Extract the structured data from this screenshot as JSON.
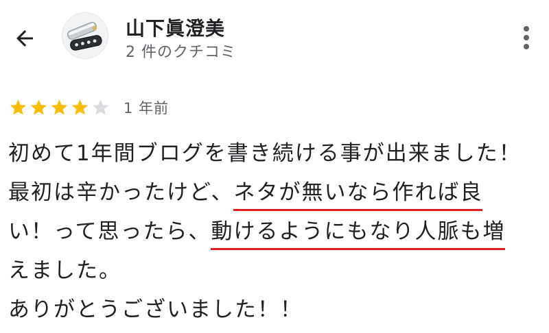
{
  "reviewer": {
    "name": "山下眞澄美",
    "review_count": "2 件のクチコミ"
  },
  "review": {
    "rating": 4,
    "rating_max": 5,
    "time": "1 年前",
    "lines": [
      [
        "初めて1年間ブログを書き続ける事が出来ました！",
        ""
      ],
      [
        "最初は辛かったけど、",
        "ネタが無いなら作れば良"
      ],
      [
        "い！って思ったら、",
        "動けるようにもなり人脈も増"
      ],
      [
        "えました。",
        ""
      ],
      [
        "ありがとうございました！！",
        ""
      ]
    ]
  },
  "colors": {
    "star_filled": "#fbbc04",
    "star_empty": "#dadce0",
    "highlight_underline": "#e02020"
  },
  "icons": {
    "back": "arrow-back-icon",
    "more": "more-vert-icon"
  }
}
